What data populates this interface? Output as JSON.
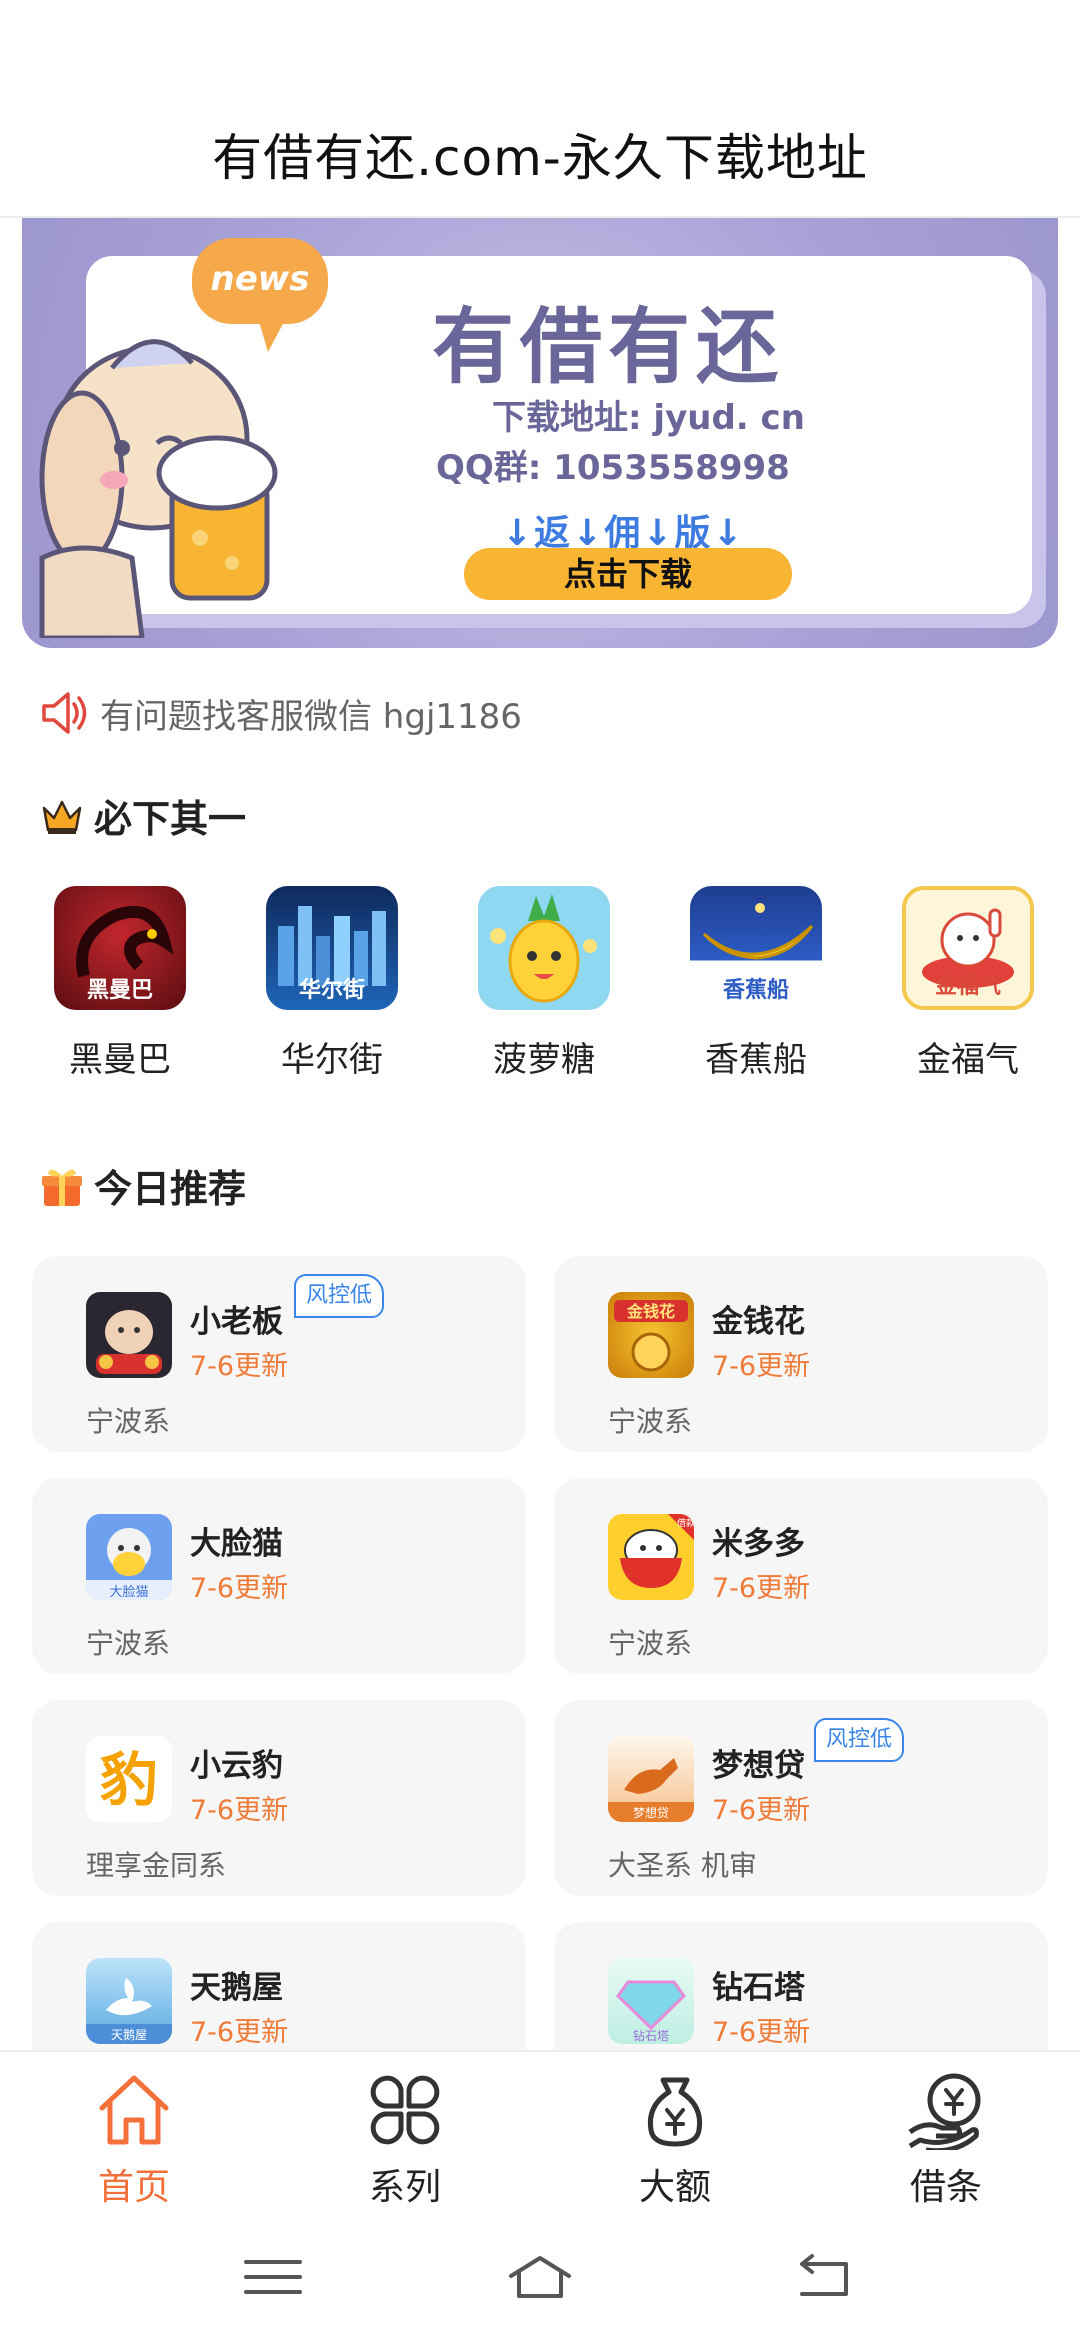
{
  "header": {
    "title": "有借有还.com-永久下载地址"
  },
  "banner": {
    "bubble": "news",
    "brand": "有借有还",
    "download": "下载地址: jyud. cn",
    "qq": "QQ群: 1053558998",
    "promo": "↓返↓佣↓版↓",
    "button": "点击下载"
  },
  "notice": {
    "text": "有问题找客服微信 hgj1186",
    "icon": "speaker-icon",
    "color": "#e0483d"
  },
  "must_download": {
    "title": "必下其一",
    "icon": "crown-icon",
    "apps": [
      {
        "name": "黑曼巴",
        "caption": "黑曼巴"
      },
      {
        "name": "华尔街",
        "caption": "华尔街"
      },
      {
        "name": "菠萝糖",
        "caption": ""
      },
      {
        "name": "香蕉船",
        "caption": "香蕉船"
      },
      {
        "name": "金福气",
        "caption": "金福气"
      }
    ]
  },
  "today": {
    "title": "今日推荐",
    "icon": "gift-icon",
    "items": [
      {
        "name": "小老板",
        "update": "7-6更新",
        "type": "宁波系",
        "badge": "风控低"
      },
      {
        "name": "金钱花",
        "update": "7-6更新",
        "type": "宁波系",
        "badge": "",
        "icon_text": "金钱花"
      },
      {
        "name": "大脸猫",
        "update": "7-6更新",
        "type": "宁波系",
        "badge": "",
        "icon_text": "大脸猫"
      },
      {
        "name": "米多多",
        "update": "7-6更新",
        "type": "宁波系",
        "badge": "",
        "icon_text": "借款"
      },
      {
        "name": "小云豹",
        "update": "7-6更新",
        "type": "理享金同系",
        "badge": "",
        "icon_text": "豹"
      },
      {
        "name": "梦想贷",
        "update": "7-6更新",
        "type": "大圣系 机审",
        "badge": "风控低",
        "icon_text": "梦想贷"
      },
      {
        "name": "天鹅屋",
        "update": "7-6更新",
        "type": "",
        "badge": "",
        "icon_text": "天鹅屋"
      },
      {
        "name": "钻石塔",
        "update": "7-6更新",
        "type": "",
        "badge": "",
        "icon_text": "钻石塔"
      }
    ]
  },
  "nav": {
    "items": [
      {
        "label": "首页",
        "icon": "home-icon"
      },
      {
        "label": "系列",
        "icon": "grid-icon"
      },
      {
        "label": "大额",
        "icon": "money-bag-icon"
      },
      {
        "label": "借条",
        "icon": "loan-hand-icon"
      }
    ],
    "active_color": "#f4703a"
  },
  "system": {
    "icons": [
      "menu-icon",
      "home-outline-icon",
      "back-icon"
    ]
  }
}
